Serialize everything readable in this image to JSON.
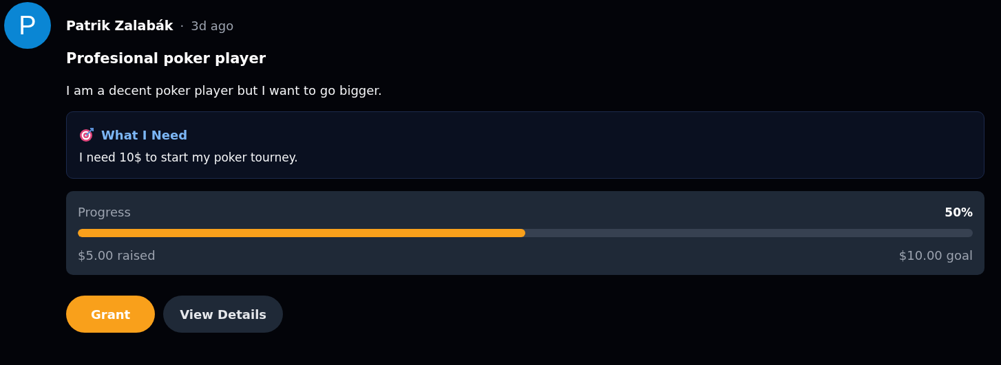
{
  "post": {
    "avatar_letter": "P",
    "author": "Patrik Zalabák",
    "separator": "·",
    "time": "3d ago",
    "title": "Profesional poker player",
    "body": "I am a decent poker player but I want to go bigger.",
    "need": {
      "heading": "What I Need",
      "text": "I need 10$ to start my poker tourney."
    },
    "progress": {
      "label": "Progress",
      "percent": "50%",
      "level": 0.5,
      "raised": "$5.00 raised",
      "goal": "$10.00 goal"
    },
    "buttons": [
      {
        "label": "Grant",
        "kind": "primary"
      },
      {
        "label": "View Details",
        "kind": "secondary"
      }
    ]
  }
}
